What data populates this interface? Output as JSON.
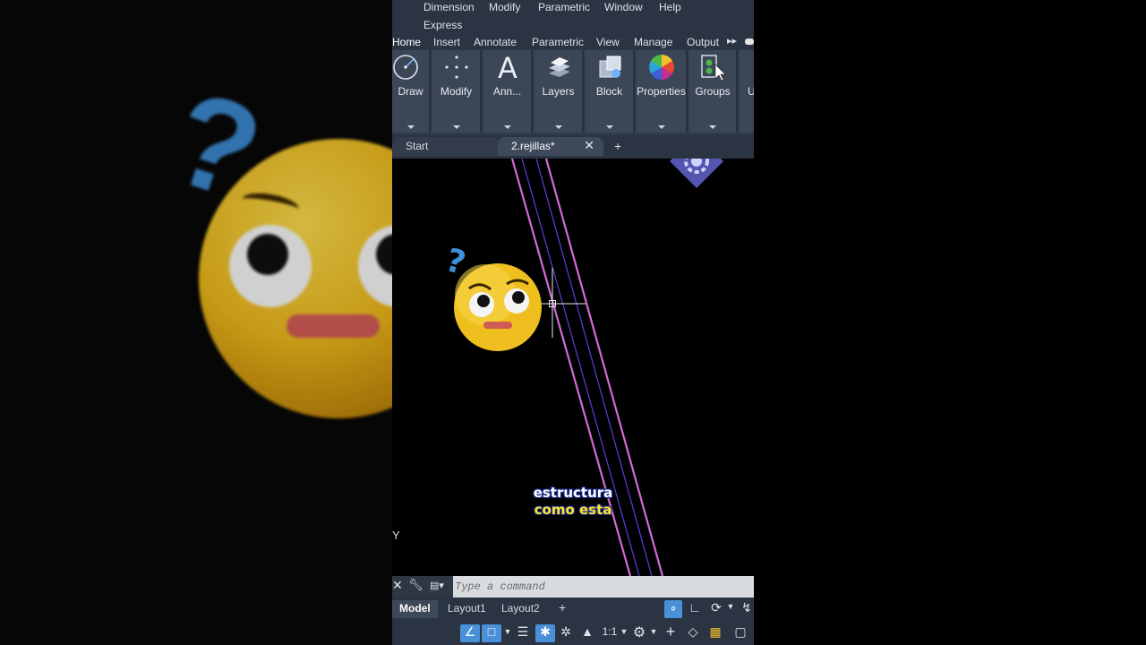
{
  "menu": [
    "Dimension",
    "Modify",
    "Parametric",
    "Window",
    "Help",
    "Express"
  ],
  "ribbon_tabs": [
    "Home",
    "Insert",
    "Annotate",
    "Parametric",
    "View",
    "Manage",
    "Output"
  ],
  "active_ribbon_tab": "Home",
  "ribbon_panels": [
    "Draw",
    "Modify",
    "Ann...",
    "Layers",
    "Block",
    "Properties",
    "Groups",
    "U"
  ],
  "doc_tabs": {
    "start": "Start",
    "file": "2.rejillas*"
  },
  "command_line": {
    "placeholder": "Type a command"
  },
  "layout_tabs": [
    "Model",
    "Layout1",
    "Layout2"
  ],
  "active_layout": "Model",
  "statusbar": {
    "scale": "1:1"
  },
  "viewport": {
    "axis_label": "Y"
  },
  "subtitle": {
    "line1": "estructura",
    "line2": "como esta"
  },
  "colors": {
    "background": "#000000",
    "ui_panel": "#2b3442",
    "ribbon": "#323c4b",
    "accent": "#4a90d9",
    "line_magenta": "#d46ad8",
    "line_blue": "#5a3ee0"
  }
}
